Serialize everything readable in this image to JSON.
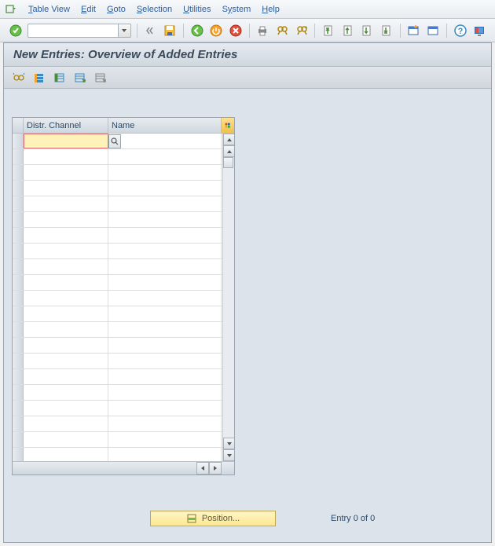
{
  "menu": {
    "items": [
      "Table View",
      "Edit",
      "Goto",
      "Selection",
      "Utilities",
      "System",
      "Help"
    ]
  },
  "toolbar": {
    "command_value": ""
  },
  "page": {
    "title": "New Entries: Overview of Added Entries"
  },
  "table": {
    "columns": {
      "col1": "Distr. Channel",
      "col2": "Name"
    },
    "active_cell_value": "",
    "row_count": 21
  },
  "footer": {
    "position_label": "Position...",
    "entry_text": "Entry 0 of 0"
  }
}
